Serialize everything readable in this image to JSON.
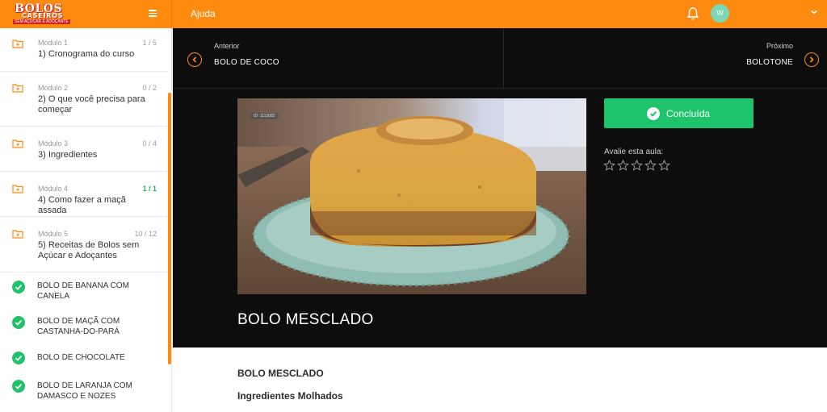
{
  "brand": {
    "line1": "BOLOS",
    "line2": "CASEIROS",
    "line3": "SEM AÇÚCAR E ADOÇANTE"
  },
  "header": {
    "help": "Ajuda",
    "avatar_initial": "W"
  },
  "sidebar": {
    "modules": [
      {
        "label": "Módulo 1",
        "count": "1 / 5",
        "title": "1) Cronograma do curso"
      },
      {
        "label": "Módulo 2",
        "count": "0 / 2",
        "title": "2) O que você precisa para começar"
      },
      {
        "label": "Módulo 3",
        "count": "0 / 4",
        "title": "3) Ingredientes"
      },
      {
        "label": "Módulo 4",
        "count": "1 / 1",
        "title": "4) Como fazer a maçã assada"
      },
      {
        "label": "Módulo 5",
        "count": "10 / 12",
        "title": "5) Receitas de Bolos sem Açúcar e Adoçantes"
      }
    ],
    "lessons": [
      {
        "title": "BOLO DE BANANA COM CANELA"
      },
      {
        "title": "BOLO DE MAÇÃ COM CASTANHA-DO-PARÁ"
      },
      {
        "title": "BOLO DE CHOCOLATE"
      },
      {
        "title": "BOLO DE LARANJA COM DAMASCO E NOZES"
      }
    ]
  },
  "nav": {
    "prev_label": "Anterior",
    "prev_title": "BOLO DE COCO",
    "next_label": "Próximo",
    "next_title": "BOLOTONE"
  },
  "lesson": {
    "video_id": "ID: 1112082",
    "title": "BOLO MESCLADO",
    "complete_label": "Concluída",
    "rate_label": "Avalie esta aula:",
    "rating": 0,
    "rating_max": 5
  },
  "content": {
    "heading": "BOLO MESCLADO",
    "subheading": "Ingredientes Molhados"
  },
  "colors": {
    "accent": "#ff8a10",
    "success": "#1ec46c",
    "dark": "#0d0d0d"
  }
}
